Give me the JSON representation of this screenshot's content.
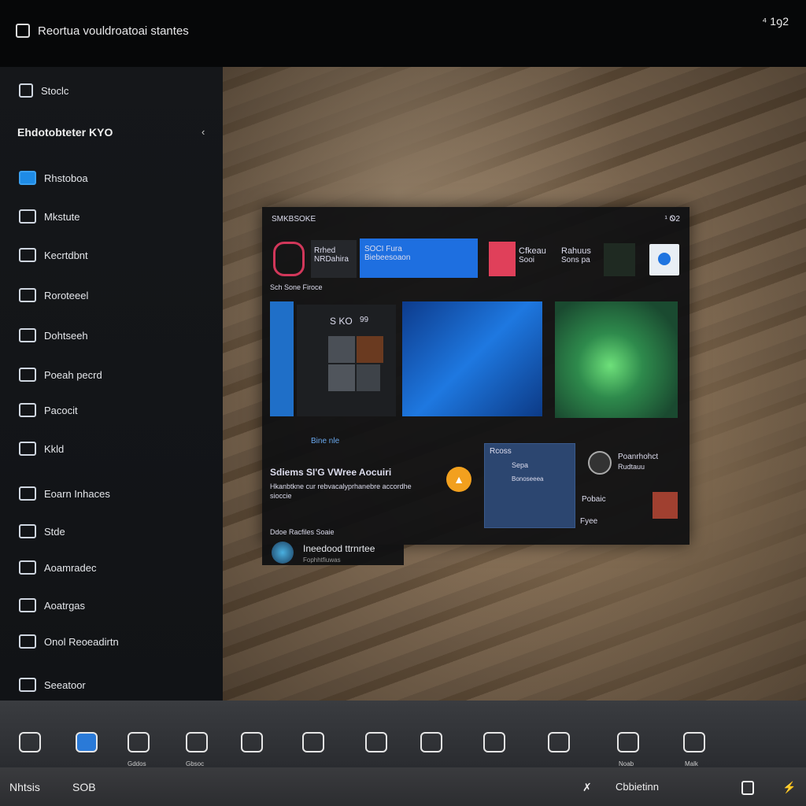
{
  "window": {
    "title": "Reortua vouldroatoai stantes",
    "top_right": "⁴ 1ꝯ2"
  },
  "sidebar": {
    "top_item": "Stoclc",
    "section": "Ehdotobteter KYO",
    "items": [
      {
        "label": "Rhstoboa",
        "icon": "monitor-icon"
      },
      {
        "label": "Mkstute",
        "icon": "display-icon"
      },
      {
        "label": "Kecrtdbnt",
        "icon": "network-icon"
      },
      {
        "label": "Roroteeel",
        "icon": "folder-icon"
      },
      {
        "label": "Dohtseeh",
        "icon": "tools-icon"
      },
      {
        "label": "Poeah pecrd",
        "icon": "globe-icon"
      },
      {
        "label": "Pacocit",
        "icon": "chart-icon"
      },
      {
        "label": "Kkld",
        "icon": "chat-icon"
      },
      {
        "label": "Eoarn Inhaces",
        "icon": "cloud-icon"
      },
      {
        "label": "Stde",
        "icon": "cloud-icon"
      },
      {
        "label": "Aoamradec",
        "icon": "layers-icon"
      },
      {
        "label": "Aoatrgas",
        "icon": "puzzle-icon"
      },
      {
        "label": "Onol Reoeadirtn",
        "icon": "gear-icon"
      },
      {
        "label": "Seeatoor",
        "icon": "apps-icon"
      }
    ]
  },
  "panel": {
    "header": "SMKBSOKE",
    "header_right": "¹ Ꮻ2",
    "row1": [
      {
        "title": "Rrhed",
        "sub": "NRDahira"
      },
      {
        "title": "SOCI Fura",
        "sub": "Biebeesoaon"
      },
      {
        "title": "Cfkeau",
        "sub": "Sooi"
      },
      {
        "title": "Rahuus",
        "sub": "Sons pa"
      }
    ],
    "section1": "Sch Sone Firoce",
    "start_label": "S KO",
    "start_num": "99",
    "link": "Bine nle",
    "heading": "Sdiems SI'G VWree Aocuiri",
    "desc": "Hkanbtkne cur rebvacalyprhanebre accordhe",
    "desc2": "sioccie",
    "widget": {
      "title": "Rcoss",
      "line1": "Sepa",
      "line2": "Bonoseeea"
    },
    "side1": {
      "title": "Poanrhohct",
      "sub": "Rudtauu"
    },
    "side2": "Pobaic",
    "side3": "Fyee",
    "footer": "Ddoe Racfiles Soaie",
    "bottom_title": "Ineedood ttrnrtee",
    "bottom_sub": "Fophhtfiuwas",
    "accent": "#1e74e0",
    "badge_color": "#f2a01e"
  },
  "dock": {
    "labels": [
      "Gddos",
      "Gbsoc",
      "Noab",
      "Malk"
    ]
  },
  "status": {
    "left1": "Nhtsis",
    "left2": "SOB",
    "right": "Cbbietinn"
  }
}
